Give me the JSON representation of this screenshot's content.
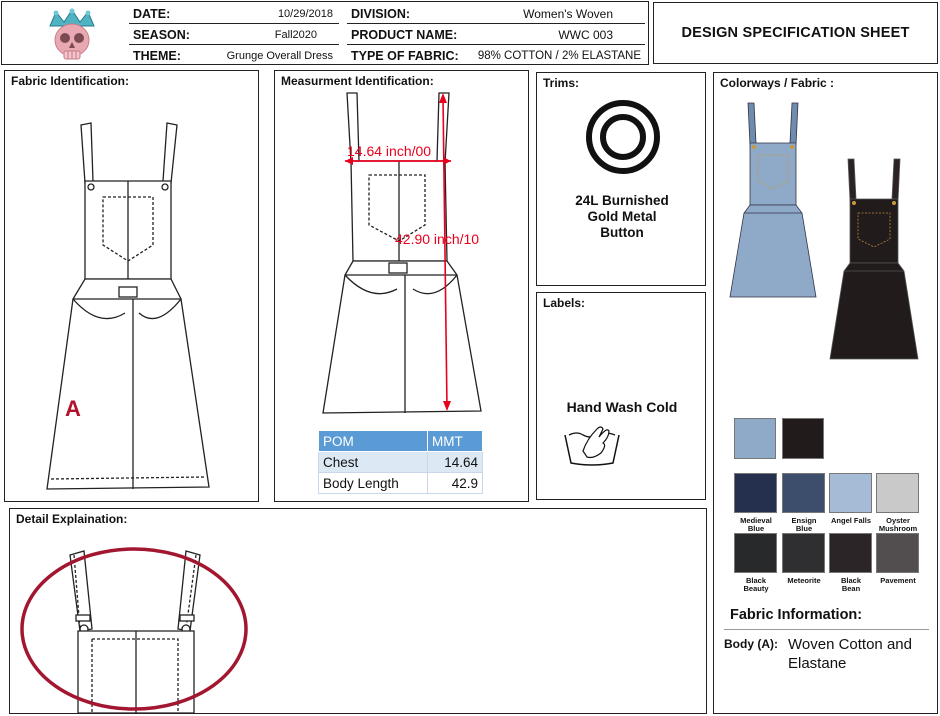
{
  "header": {
    "date_label": "DATE:",
    "date_value": "10/29/2018",
    "season_label": "SEASON:",
    "season_value": "Fall2020",
    "theme_label": "THEME:",
    "theme_value": "Grunge Overall Dress",
    "division_label": "DIVISION:",
    "division_value": "Women's Woven",
    "product_label": "PRODUCT NAME:",
    "product_value": "WWC 003",
    "fabric_label": "TYPE OF FABRIC:",
    "fabric_value": "98% COTTON / 2% ELASTANE",
    "sheet_title": "DESIGN SPECIFICATION SHEET"
  },
  "sections": {
    "fabric_identification": "Fabric Identification:",
    "measurement_identification": "Measurment Identification:",
    "trims": "Trims:",
    "labels": "Labels:",
    "colorways": "Colorways / Fabric :",
    "detail": "Detail Explaination:"
  },
  "fabric_marker": "A",
  "measurements": {
    "chest_annotation": "14.64 inch/00",
    "length_annotation": "42.90 inch/10",
    "table_headers": [
      "POM",
      "MMT"
    ],
    "rows": [
      {
        "pom": "Chest",
        "mmt": "14.64"
      },
      {
        "pom": "Body Length",
        "mmt": "42.9"
      }
    ]
  },
  "trims": {
    "name": "24L Burnished Gold Metal Button",
    "line1": "24L Burnished",
    "line2": "Gold Metal",
    "line3": "Button"
  },
  "labels": {
    "care": "Hand Wash Cold"
  },
  "colorways": {
    "swatches": [
      {
        "name": "Medieval Blue",
        "line1": "Medieval",
        "line2": "Blue",
        "color": "#25304f"
      },
      {
        "name": "Ensign Blue",
        "line1": "Ensign",
        "line2": "Blue",
        "color": "#3c4e6c"
      },
      {
        "name": "Angel Falls",
        "line1": "Angel Falls",
        "line2": "",
        "color": "#a6bcd6"
      },
      {
        "name": "Oyster Mushroom",
        "line1": "Oyster",
        "line2": "Mushroom",
        "color": "#c9c9c9"
      },
      {
        "name": "Black Beauty",
        "line1": "Black",
        "line2": "Beauty",
        "color": "#28292b"
      },
      {
        "name": "Meteorite",
        "line1": "Meteorite",
        "line2": "",
        "color": "#2f2f31"
      },
      {
        "name": "Black Bean",
        "line1": "Black",
        "line2": "Bean",
        "color": "#2c2527"
      },
      {
        "name": "Pavement",
        "line1": "Pavement",
        "line2": "",
        "color": "#524d4f"
      }
    ],
    "fabric_colors": [
      "#8fa9c9",
      "#221b1c"
    ]
  },
  "fabric_information": {
    "title": "Fabric Information:",
    "body_label": "Body (A):",
    "body_line1": "Woven Cotton and",
    "body_line2": "Elastane"
  },
  "colors": {
    "accent_red": "#e8001c",
    "detail_ellipse": "#a3162f",
    "marker_red": "#b3122c",
    "table_header": "#5b9bd5"
  }
}
